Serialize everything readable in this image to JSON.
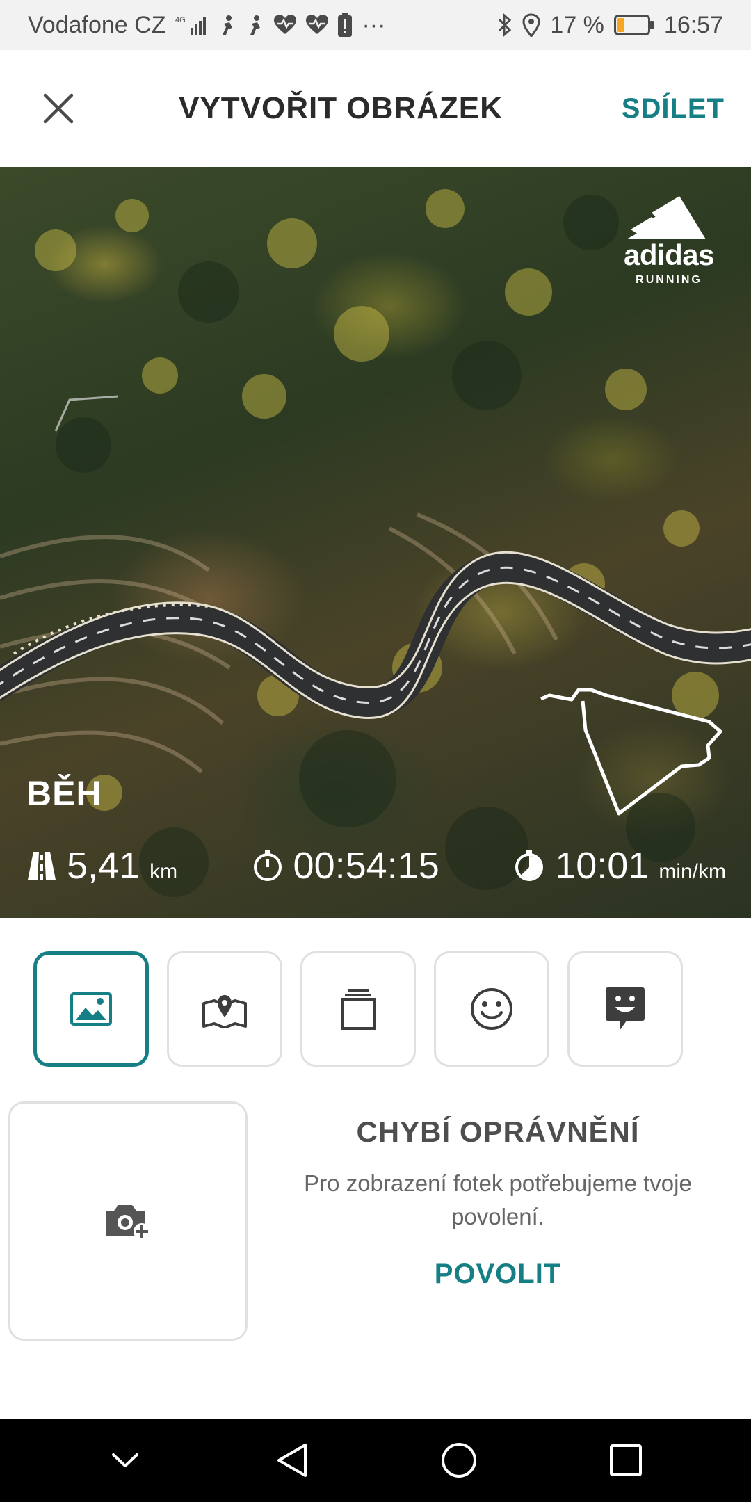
{
  "status_bar": {
    "carrier": "Vodafone CZ",
    "network": "4G",
    "more": "···",
    "battery_percent": "17 %",
    "time": "16:57",
    "icons": [
      "signal-icon",
      "run-notification-icon",
      "run-notification-icon",
      "heart-rate-icon",
      "heart-rate-icon",
      "battery-alert-icon",
      "bluetooth-icon",
      "location-icon",
      "battery-icon"
    ]
  },
  "header": {
    "title": "VYTVOŘIT OBRÁZEK",
    "share_label": "SDÍLET",
    "close_icon": "close-icon"
  },
  "preview": {
    "brand_name": "adidas",
    "brand_sub": "RUNNING",
    "activity_type": "BĚH",
    "stats": [
      {
        "icon": "road-icon",
        "value": "5,41",
        "unit": "km"
      },
      {
        "icon": "stopwatch-icon",
        "value": "00:54:15",
        "unit": ""
      },
      {
        "icon": "pace-icon",
        "value": "10:01",
        "unit": "min/km"
      }
    ]
  },
  "toolbar": {
    "active_index": 0,
    "items": [
      {
        "icon": "image-icon",
        "selected": true
      },
      {
        "icon": "map-icon",
        "selected": false
      },
      {
        "icon": "layers-icon",
        "selected": false
      },
      {
        "icon": "smiley-icon",
        "selected": false
      },
      {
        "icon": "sticker-icon",
        "selected": false
      }
    ]
  },
  "permission": {
    "title": "CHYBÍ OPRÁVNĚNÍ",
    "text": "Pro zobrazení fotek potřebujeme tvoje povolení.",
    "allow_label": "POVOLIT",
    "tile_icon": "add-photo-camera-icon"
  },
  "nav_bar": {
    "buttons": [
      "hide-keyboard-icon",
      "back-icon",
      "home-icon",
      "recents-icon"
    ]
  },
  "colors": {
    "accent": "#167f86",
    "text_dark": "#2b2b2b",
    "border": "#e0e0e0"
  }
}
